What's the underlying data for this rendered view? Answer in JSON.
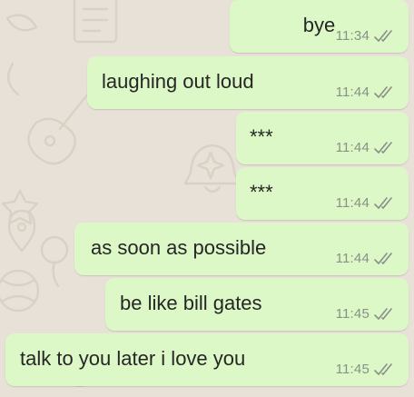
{
  "chat": {
    "messages": [
      {
        "text": "bye",
        "time": "11:34",
        "status_icon": "double-check-icon"
      },
      {
        "text": "laughing out loud",
        "time": "11:44",
        "status_icon": "double-check-icon"
      },
      {
        "text": "***",
        "time": "11:44",
        "status_icon": "double-check-icon"
      },
      {
        "text": "***",
        "time": "11:44",
        "status_icon": "double-check-icon"
      },
      {
        "text": "as soon as possible",
        "time": "11:44",
        "status_icon": "double-check-icon"
      },
      {
        "text": "be like bill gates",
        "time": "11:45",
        "status_icon": "double-check-icon"
      },
      {
        "text": "talk to you later i love you",
        "time": "11:45",
        "status_icon": "double-check-icon"
      }
    ]
  },
  "colors": {
    "outgoing_bubble": "#dcf8c6",
    "chat_background": "#e8e1d8",
    "message_text": "#262626",
    "meta_text": "#8a8f88"
  }
}
